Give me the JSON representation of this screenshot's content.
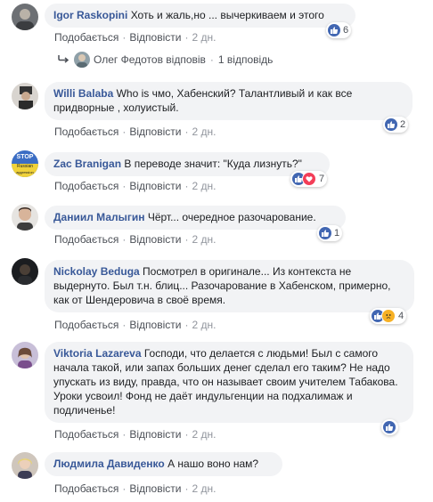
{
  "actions": {
    "like": "Подобається",
    "reply": "Відповісти"
  },
  "reply_summary": {
    "name": "Олег Федотов відповів",
    "count": "1 відповідь"
  },
  "comments": [
    {
      "author": "Igor Raskopini",
      "text": "Хоть и жаль,но ... вычеркиваем и этого",
      "time": "2 дн.",
      "reactions": "6",
      "reaction_types": [
        "like"
      ]
    },
    {
      "author": "Willi Balaba",
      "text": "Who is чмо, Хабенский? Талантливый и как все придворные , холуистый.",
      "time": "2 дн.",
      "reactions": "2",
      "reaction_types": [
        "like"
      ]
    },
    {
      "author": "Zac Branigan",
      "text": "В переводе значит: \"Куда лизнуть?\"",
      "time": "2 дн.",
      "reactions": "7",
      "reaction_types": [
        "like",
        "love"
      ],
      "avatar_text": [
        "STOP",
        "Russian",
        "aggression"
      ]
    },
    {
      "author": "Даниил Малыгин",
      "text": "Чёрт... очередное разочарование.",
      "time": "2 дн.",
      "reactions": "1",
      "reaction_types": [
        "like"
      ]
    },
    {
      "author": "Nickolay Beduga",
      "text": "Посмотрел в оригинале... Из контекста не выдернуто. Был т.н. блиц... Разочарование в Хабенском, примерно, как от Шендеровича в своё время.",
      "time": "2 дн.",
      "reactions": "4",
      "reaction_types": [
        "like",
        "sad"
      ]
    },
    {
      "author": "Viktoria Lazareva",
      "text": "Господи, что делается с людьми! Был с самого начала такой, или запах больших денег сделал его таким? Не надо упускать из виду, правда, что он называет своим учителем Табакова. Уроки усвоил! Фонд не даёт индульгенции на подхалимаж и подличенье!",
      "time": "2 дн.",
      "reactions": "",
      "reaction_types": [
        "like"
      ]
    },
    {
      "author": "Людмила Давиденко",
      "text": "А нашо воно нам?",
      "time": "2 дн.",
      "reactions": "",
      "reaction_types": []
    }
  ],
  "colors": {
    "link": "#385898",
    "bubble": "#f2f3f5",
    "like": "#4267b2",
    "love": "#f33e58",
    "sad": "#f7b125"
  }
}
